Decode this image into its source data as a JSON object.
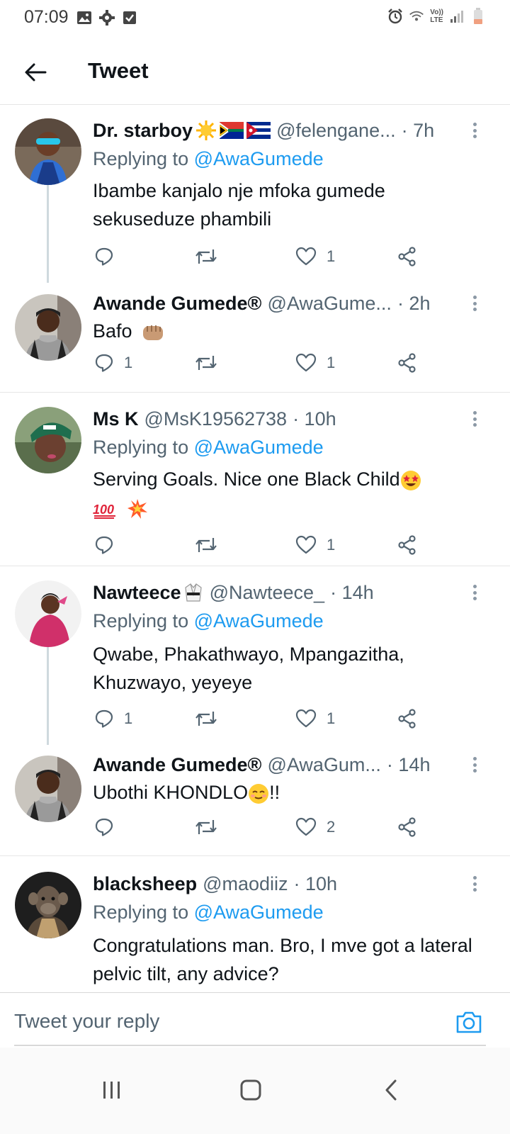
{
  "status_bar": {
    "time": "07:09",
    "left_icons": [
      "image-icon",
      "gear-icon",
      "checkbox-icon"
    ],
    "right_icons": [
      "alarm-icon",
      "wifi-icon",
      "volte-icon",
      "signal-icon",
      "battery-icon"
    ],
    "volte_top": "Vo))",
    "volte_bottom": "LTE"
  },
  "header": {
    "title": "Tweet",
    "back_icon": "arrow-left-icon"
  },
  "tweets": [
    {
      "name": "Dr. starboy",
      "name_emojis": [
        "sun-emoji",
        "south-africa-flag-emoji",
        "cuba-flag-emoji"
      ],
      "handle": "@felengane...",
      "time": "· 7h",
      "replying_prefix": "Replying to",
      "replying_to": "@AwaGumede",
      "text": "Ibambe kanjalo nje mfoka gumede sekuseduze phambili",
      "reply_count": "",
      "retweet_count": "",
      "like_count": "1"
    },
    {
      "name": "Awande Gumede®",
      "handle": "@AwaGume...",
      "time": "· 2h",
      "text": "Bafo",
      "text_emoji": "fist-emoji",
      "reply_count": "1",
      "retweet_count": "",
      "like_count": "1"
    },
    {
      "name": "Ms K",
      "handle": "@MsK19562738",
      "time": "· 10h",
      "replying_prefix": "Replying to",
      "replying_to": "@AwaGumede",
      "text_line1": "Serving Goals. Nice one Black Child",
      "text_emojis": [
        "star-struck-emoji",
        "hundred-points-emoji",
        "collision-emoji"
      ],
      "reply_count": "",
      "retweet_count": "",
      "like_count": "1"
    },
    {
      "name": "Nawteece",
      "name_emojis": [
        "martial-arts-uniform-emoji"
      ],
      "handle": "@Nawteece_",
      "time": "· 14h",
      "replying_prefix": "Replying to",
      "replying_to": "@AwaGumede",
      "text": "Qwabe, Phakathwayo, Mpangazitha, Khuzwayo, yeyeye",
      "reply_count": "1",
      "retweet_count": "",
      "like_count": "1"
    },
    {
      "name": "Awande Gumede®",
      "handle": "@AwaGum...",
      "time": "· 14h",
      "text_before": "Ubothi KHONDLO",
      "text_emoji": "relieved-face-emoji",
      "text_after": "!!",
      "reply_count": "",
      "retweet_count": "",
      "like_count": "2"
    },
    {
      "name": "blacksheep",
      "handle": "@maodiiz",
      "time": "· 10h",
      "replying_prefix": "Replying to",
      "replying_to": "@AwaGumede",
      "text": "Congratulations man. Bro, I mve got a lateral pelvic tilt, any advice?"
    }
  ],
  "reply_bar": {
    "placeholder": "Tweet your reply",
    "camera_icon": "camera-icon"
  },
  "nav_bar": {
    "icons": [
      "recent-apps-icon",
      "home-icon",
      "back-icon"
    ]
  },
  "colors": {
    "link": "#1d9bf0",
    "secondary_text": "#536471",
    "text": "#0f1419",
    "divider": "#e6e6e6",
    "thread_line": "#cfd9de"
  }
}
